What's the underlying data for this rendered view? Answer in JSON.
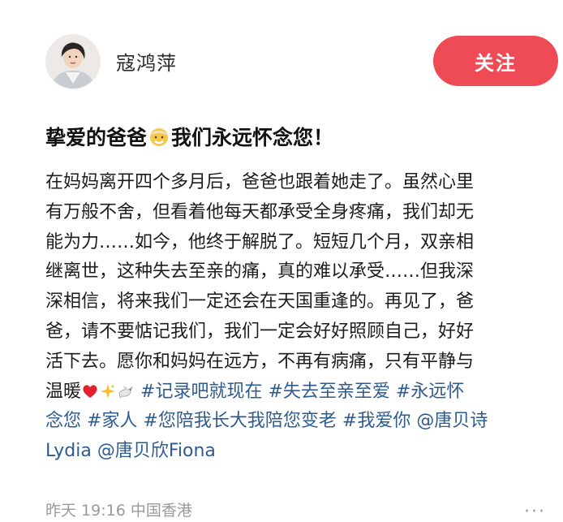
{
  "author": {
    "name": "寇鸿萍",
    "follow_label": "关注"
  },
  "post": {
    "title_part1": "挚爱的爸爸",
    "title_part2": "我们永远怀念您！",
    "lines": {
      "l1": "在妈妈离开四个多月后，爸爸也跟着她走了。虽然心里",
      "l2": "有万般不舍，但看着他每天都承受全身疼痛，我们却无",
      "l3": "能为力……如今，他终于解脱了。短短几个月，双亲相",
      "l4": "继离世，这种失去至亲的痛，真的难以承受……但我深",
      "l5": "深相信，将来我们一定还会在天国重逢的。再见了，爸",
      "l6": "爸，请不要惦记我们，我们一定会好好照顾自己，好好",
      "l7": "活下去。愿你和妈妈在远方，不再有病痛，只有平静与",
      "l8_text": "温暖"
    },
    "tags": {
      "t1": "#记录吧就现在",
      "t2": "#失去至亲至爱",
      "t3a": "#永远怀",
      "t3b": "念您",
      "t4": "#家人",
      "t5": "#您陪我长大我陪您变老",
      "t6": "#我爱你",
      "m1a": "@唐贝诗",
      "m1b": "Lydia",
      "m2": "@唐贝欣Fiona"
    }
  },
  "meta": {
    "time": "昨天 19:16",
    "location": "中国香港",
    "more": "···"
  },
  "colors": {
    "accent": "#ee4b57",
    "tag": "#2f5b8f",
    "muted": "#9a9a9a"
  },
  "icons": [
    "avatar-photo",
    "old-man-emoji",
    "red-heart-emoji",
    "sparkle-emoji",
    "dove-emoji",
    "more-icon"
  ]
}
